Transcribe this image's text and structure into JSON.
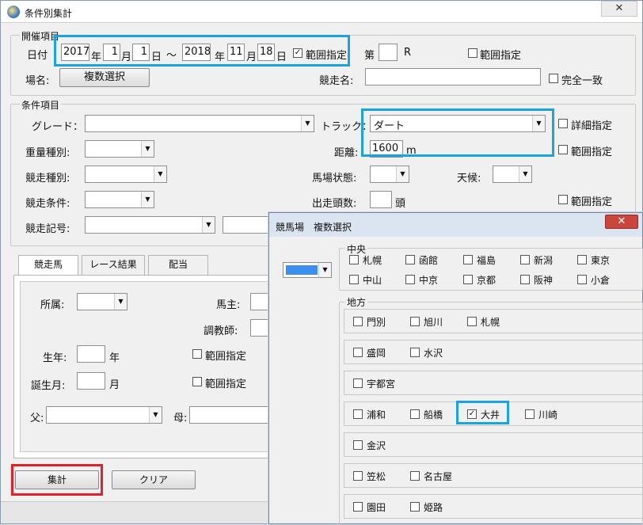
{
  "window": {
    "title": "条件別集計",
    "close_glyph": "✕"
  },
  "kaisai": {
    "group_label": "開催項目",
    "date_label": "日付",
    "from_year": "2017",
    "year_unit": "年",
    "from_month": "1",
    "month_unit": "月",
    "from_day": "1",
    "day_unit": "日",
    "tilde": "～",
    "to_year": "2018",
    "to_month": "11",
    "to_day": "18",
    "range_label": "範囲指定",
    "dai_label": "第",
    "dai_value": "",
    "r_label": "R",
    "range2_label": "範囲指定",
    "place_label": "場名:",
    "multi_select_button": "複数選択",
    "race_name_label": "競走名:",
    "race_name_value": "",
    "exact_label": "完全一致"
  },
  "joken": {
    "group_label": "条件項目",
    "grade_label": "グレード：",
    "track_label": "トラック：",
    "track_value": "ダート",
    "detail_label": "詳細指定",
    "weight_label": "重量種別:",
    "distance_label": "距離:",
    "distance_value": "1600",
    "distance_unit": "m",
    "distance_range_label": "範囲指定",
    "race_type_label": "競走種別:",
    "baba_label": "馬場状態:",
    "weather_label": "天候:",
    "race_cond_label": "競走条件:",
    "runners_label": "出走頭数:",
    "runners_unit": "頭",
    "runners_range_label": "範囲指定",
    "race_mark_label": "競走記号:"
  },
  "tabs": [
    {
      "label": "競走馬"
    },
    {
      "label": "レース結果"
    },
    {
      "label": "配当"
    }
  ],
  "horse": {
    "affiliation_label": "所属:",
    "owner_label": "馬主:",
    "trainer_label": "調教師:",
    "birth_year_label": "生年:",
    "birth_year_unit": "年",
    "birth_year_range": "範囲指定",
    "birth_month_label": "誕生月:",
    "birth_month_unit": "月",
    "birth_month_range": "範囲指定",
    "father_label": "父:",
    "mother_label": "母:"
  },
  "buttons": {
    "aggregate": "集計",
    "clear": "クリア"
  },
  "popup": {
    "title": "競馬場　複数選択",
    "close_glyph": "✕",
    "selector_color": "#3b8ff0",
    "central_label": "中央",
    "central": [
      {
        "name": "札幌",
        "checked": false
      },
      {
        "name": "函館",
        "checked": false
      },
      {
        "name": "福島",
        "checked": false
      },
      {
        "name": "新潟",
        "checked": false
      },
      {
        "name": "東京",
        "checked": false
      },
      {
        "name": "中山",
        "checked": false
      },
      {
        "name": "中京",
        "checked": false
      },
      {
        "name": "京都",
        "checked": false
      },
      {
        "name": "阪神",
        "checked": false
      },
      {
        "name": "小倉",
        "checked": false
      }
    ],
    "local_label": "地方",
    "local_rows": [
      [
        {
          "name": "門別",
          "checked": false
        },
        {
          "name": "旭川",
          "checked": false
        },
        {
          "name": "札幌",
          "checked": false
        }
      ],
      [
        {
          "name": "盛岡",
          "checked": false
        },
        {
          "name": "水沢",
          "checked": false
        }
      ],
      [
        {
          "name": "宇都宮",
          "checked": false
        }
      ],
      [
        {
          "name": "浦和",
          "checked": false
        },
        {
          "name": "船橋",
          "checked": false
        },
        {
          "name": "大井",
          "checked": true
        },
        {
          "name": "川崎",
          "checked": false
        }
      ],
      [
        {
          "name": "金沢",
          "checked": false
        }
      ],
      [
        {
          "name": "笠松",
          "checked": false
        },
        {
          "name": "名古屋",
          "checked": false
        }
      ],
      [
        {
          "name": "園田",
          "checked": false
        },
        {
          "name": "姫路",
          "checked": false
        }
      ]
    ]
  },
  "colors": {
    "highlight_blue": "#1aa3e0",
    "highlight_red": "#e3202a"
  }
}
